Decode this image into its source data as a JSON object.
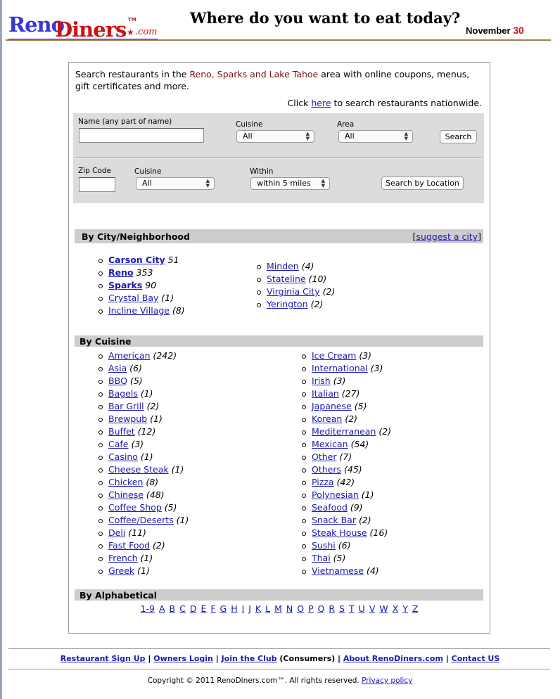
{
  "header": {
    "logo_reno": "Reno",
    "logo_diners": "Diners",
    "logo_tm": "TM",
    "logo_com": ".com",
    "tagline": "Where do you want to eat today?",
    "date_month": "November",
    "date_day": "30"
  },
  "intro": {
    "text_before": "Search restaurants in the ",
    "highlight": "Reno, Sparks and Lake Tahoe",
    "text_after": " area with online coupons, menus, gift certificates and more.",
    "nation_prefix": "Click ",
    "nation_link": "here",
    "nation_suffix": " to search restaurants nationwide."
  },
  "search": {
    "name_label": "Name (any part of name)",
    "name_value": "",
    "cuisine_label": "Cuisine",
    "cuisine_value": "All",
    "area_label": "Area",
    "area_value": "All",
    "search_button": "Search",
    "zip_label": "Zip Code",
    "zip_value": "",
    "cuisine2_label": "Cuisine",
    "cuisine2_value": "All",
    "within_label": "Within",
    "within_value": "within 5 miles",
    "location_button": "Search by Location"
  },
  "city_section": {
    "title": "By City/Neighborhood",
    "suggest_open": "[",
    "suggest_link": "suggest a city",
    "suggest_close": "]",
    "col1": [
      {
        "name": "Carson City",
        "count": "51",
        "bold": true
      },
      {
        "name": "Reno",
        "count": "353",
        "bold": true
      },
      {
        "name": "Sparks",
        "count": "90",
        "bold": true
      },
      {
        "name": "Crystal Bay",
        "count": "(1)",
        "bold": false
      },
      {
        "name": "Incline Village",
        "count": "(8)",
        "bold": false
      }
    ],
    "col2": [
      {
        "name": "Minden",
        "count": "(4)"
      },
      {
        "name": "Stateline",
        "count": "(10)"
      },
      {
        "name": "Virginia City",
        "count": "(2)"
      },
      {
        "name": "Yerington",
        "count": "(2)"
      }
    ]
  },
  "cuisine_section": {
    "title": "By Cuisine",
    "col1": [
      {
        "name": "American",
        "count": "(242)"
      },
      {
        "name": "Asia",
        "count": "(6)"
      },
      {
        "name": "BBQ",
        "count": "(5)"
      },
      {
        "name": "Bagels",
        "count": "(1)"
      },
      {
        "name": "Bar Grill",
        "count": "(2)"
      },
      {
        "name": "Brewpub",
        "count": "(1)"
      },
      {
        "name": "Buffet",
        "count": "(12)"
      },
      {
        "name": "Cafe",
        "count": "(3)"
      },
      {
        "name": "Casino",
        "count": "(1)"
      },
      {
        "name": "Cheese Steak",
        "count": "(1)"
      },
      {
        "name": "Chicken",
        "count": "(8)"
      },
      {
        "name": "Chinese",
        "count": "(48)"
      },
      {
        "name": "Coffee Shop",
        "count": "(5)"
      },
      {
        "name": "Coffee/Deserts",
        "count": "(1)"
      },
      {
        "name": "Deli",
        "count": "(11)"
      },
      {
        "name": "Fast Food",
        "count": "(2)"
      },
      {
        "name": "French",
        "count": "(1)"
      },
      {
        "name": "Greek",
        "count": "(1)"
      }
    ],
    "col2": [
      {
        "name": "Ice Cream",
        "count": "(3)"
      },
      {
        "name": "International",
        "count": "(3)"
      },
      {
        "name": "Irish",
        "count": "(3)"
      },
      {
        "name": "Italian",
        "count": "(27)"
      },
      {
        "name": "Japanese",
        "count": "(5)"
      },
      {
        "name": "Korean",
        "count": "(2)"
      },
      {
        "name": "Mediterranean",
        "count": "(2)"
      },
      {
        "name": "Mexican",
        "count": "(54)"
      },
      {
        "name": "Other",
        "count": "(7)"
      },
      {
        "name": "Others",
        "count": "(45)"
      },
      {
        "name": "Pizza",
        "count": "(42)"
      },
      {
        "name": "Polynesian",
        "count": "(1)"
      },
      {
        "name": "Seafood",
        "count": "(9)"
      },
      {
        "name": "Snack Bar",
        "count": "(2)"
      },
      {
        "name": "Steak House",
        "count": "(16)"
      },
      {
        "name": "Sushi",
        "count": "(6)"
      },
      {
        "name": "Thai",
        "count": "(5)"
      },
      {
        "name": "Vietnamese",
        "count": "(4)"
      }
    ]
  },
  "alpha_section": {
    "title": "By Alphabetical",
    "letters": [
      "1-9",
      "A",
      "B",
      "C",
      "D",
      "E",
      "F",
      "G",
      "H",
      "I",
      "J",
      "K",
      "L",
      "M",
      "N",
      "O",
      "P",
      "Q",
      "R",
      "S",
      "T",
      "U",
      "V",
      "W",
      "X",
      "Y",
      "Z"
    ]
  },
  "footer": {
    "links": [
      {
        "label": "Restaurant Sign Up",
        "suffix": ""
      },
      {
        "label": "Owners Login",
        "suffix": ""
      },
      {
        "label": "Join the Club",
        "suffix": " (Consumers)"
      },
      {
        "label": "About RenoDiners.com",
        "suffix": ""
      },
      {
        "label": "Contact US",
        "suffix": ""
      }
    ],
    "copyright": "Copyright © 2011 RenoDiners.com™. All rights reserved. ",
    "privacy": "Privacy policy"
  },
  "colors": {
    "link": "#1a1ab0",
    "logo_blue": "#3a36d6",
    "logo_red": "#cc1111",
    "highlight": "#7a1010",
    "bar_gray": "#cdcdcd",
    "panel_gray": "#dcdcdc"
  }
}
